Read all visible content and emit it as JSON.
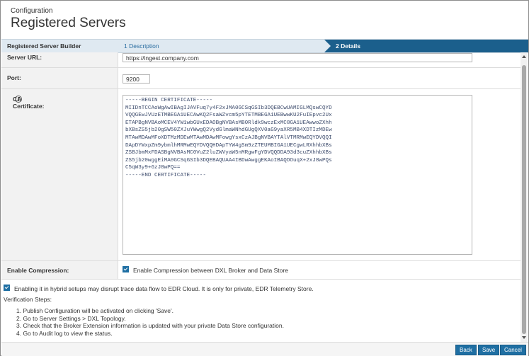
{
  "header": {
    "breadcrumb": "Configuration",
    "title": "Registered Servers"
  },
  "wizard": {
    "builder_label": "Registered Server Builder",
    "steps": [
      {
        "label": "1 Description",
        "active": false
      },
      {
        "label": "2 Details",
        "active": true
      }
    ]
  },
  "form": {
    "server_url": {
      "label": "Server URL:",
      "value": "https://ingest.company.com"
    },
    "port": {
      "label": "Port:",
      "value": "9200"
    },
    "ca_certificate": {
      "label": "CA Certificate:",
      "info_icon": "info-icon",
      "value": "-----BEGIN CERTIFICATE-----\nMIIDnTCCAoWgAwIBAgIJAVFuq7y4F2xJMA0GCSqGSIb3DQEBCwUAMIGLMQswCQYD\nVQQGEwJVUzETMBEGA1UECAwKQ2FsaWZvcm5pYTETMBEGA1UEBwwKU2FuIEpvc2Ux\nETAPBgNVBAoMCEV4YW1wbGUxEDAOBgNVBAsMB0Rldk9wczExMC8GA1UEAwwoZXhh\nbXBsZS5jb20gSW50ZXJuYWwgQ2VydGlmaWNhdGUgQXV0aG9yaXR5MB4XDTIzMDEw\nMTAwMDAwMFoXDTMzMDEwMTAwMDAwMFowgYsxCzAJBgNVBAYTAlVTMRMwEQYDVQQI\nDApDYWxpZm9ybmlhMRMwEQYDVQQHDApTYW4gSm9zZTEUMBIGA1UECgwLRXhhbXBs\nZSBJbmMxFDASBgNVBAsMC0VuZ2luZWVyaW5nMRgwFgYDVQQDDA93d3cuZXhhbXBs\nZS5jb20wggEiMA0GCSqGSIb3DQEBAQUAA4IBDwAwggEKAoIBAQDOuqX+2xJ8wPQs\nC5qW3y9+6zJ8wPQ==\n-----END CERTIFICATE-----"
    },
    "enable_compression": {
      "label": "Enable Compression:",
      "checkbox_label": "Enable Compression between DXL Broker and Data Store",
      "checked": true
    }
  },
  "hybrid_notice": {
    "checked": true,
    "text": "Enabling it in hybrid setups may disrupt trace data flow to EDR Cloud. It is only for private, EDR Telemetry Store."
  },
  "verification": {
    "title": "Verification Steps:",
    "steps": [
      "1. Publish Configuration will be activated on clicking 'Save'.",
      "2. Go to Server Settings > DXL Topology.",
      "3. Check that the Broker Extension information is updated with your private Data Store configuration.",
      "4. Go to Audit log to view the status."
    ]
  },
  "footer": {
    "back": "Back",
    "save": "Save",
    "cancel": "Cancel"
  },
  "colors": {
    "accent": "#1f6fa3",
    "active_step": "#1b5f8c",
    "step_bar": "#dfe9f1"
  }
}
